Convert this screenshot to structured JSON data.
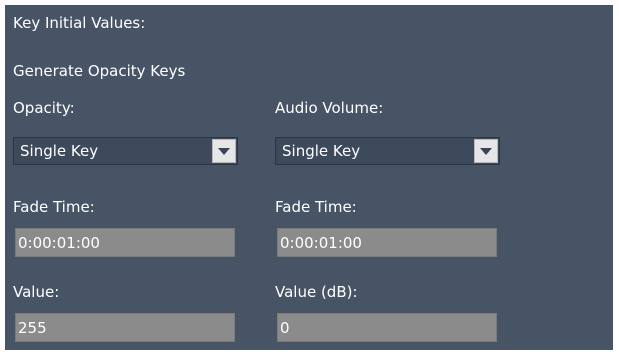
{
  "section_title": "Key Initial Values:",
  "generate_label": "Generate Opacity Keys",
  "opacity": {
    "label": "Opacity:",
    "mode": "Single Key",
    "fade_time_label": "Fade Time:",
    "fade_time": "0:00:01:00",
    "value_label": "Value:",
    "value": "255"
  },
  "audio": {
    "label": "Audio Volume:",
    "mode": "Single Key",
    "fade_time_label": "Fade Time:",
    "fade_time": "0:00:01:00",
    "value_label": "Value (dB):",
    "value": "0"
  },
  "icons": {
    "dropdown_arrow": "chevron-down-icon"
  },
  "colors": {
    "panel_background": "#475466",
    "field_background": "#8b8b8b",
    "text": "#ffffff"
  }
}
